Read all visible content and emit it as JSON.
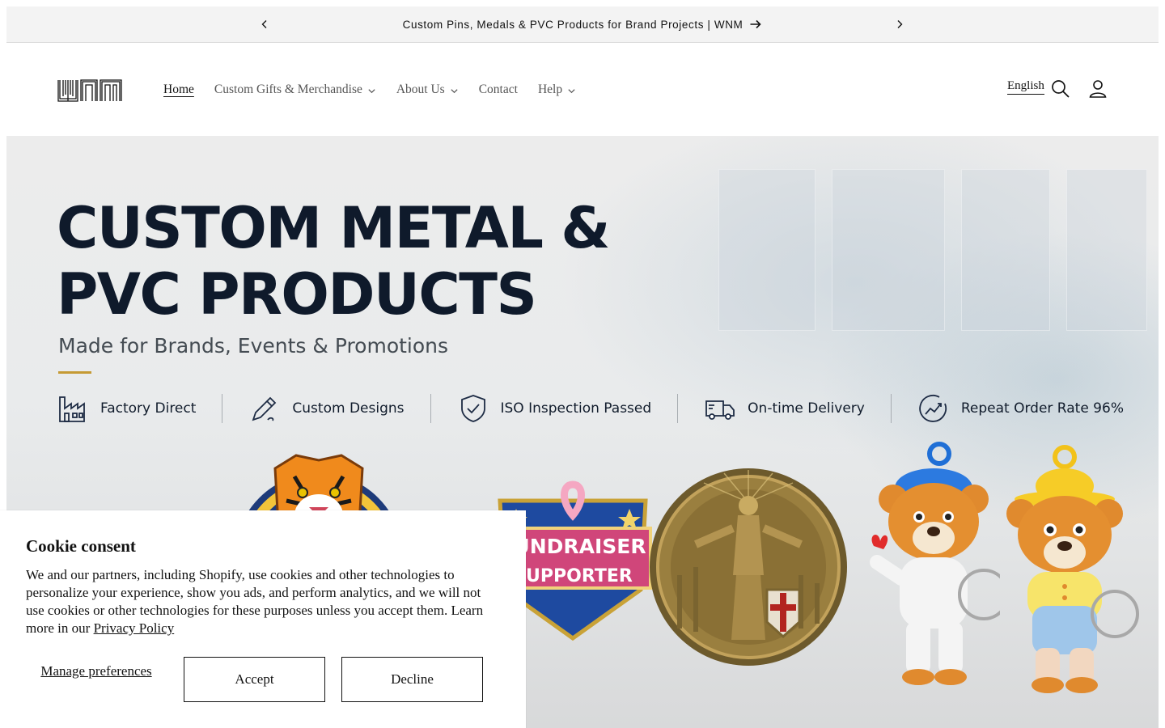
{
  "announcement": {
    "text": "Custom Pins, Medals & PVC Products for Brand Projects | WNM",
    "prev_icon": "chevron-left-icon",
    "next_icon": "chevron-right-icon",
    "arrow_icon": "arrow-right-icon"
  },
  "header": {
    "logo_text": "WNM",
    "nav": [
      {
        "label": "Home",
        "active": true,
        "dropdown": false
      },
      {
        "label": "Custom Gifts & Merchandise",
        "active": false,
        "dropdown": true
      },
      {
        "label": "About Us",
        "active": false,
        "dropdown": true
      },
      {
        "label": "Contact",
        "active": false,
        "dropdown": false
      },
      {
        "label": "Help",
        "active": false,
        "dropdown": true
      }
    ],
    "language": "English",
    "search_icon": "search-icon",
    "account_icon": "account-icon"
  },
  "hero": {
    "title": "CUSTOM METAL &\nPVC PRODUCTS",
    "subtitle": "Made for Brands, Events & Promotions",
    "features": [
      {
        "icon": "factory-icon",
        "label": "Factory Direct"
      },
      {
        "icon": "pencil-icon",
        "label": "Custom Designs"
      },
      {
        "icon": "shield-check-icon",
        "label": "ISO Inspection Passed"
      },
      {
        "icon": "delivery-truck-icon",
        "label": "On-time Delivery"
      },
      {
        "icon": "growth-chart-icon",
        "label": "Repeat Order Rate 96%"
      }
    ],
    "products": {
      "fund_pin_line1": "FUNDRAISER",
      "fund_pin_line2": "SUPPORTER"
    }
  },
  "cookie": {
    "title": "Cookie consent",
    "body": "We and our partners, including Shopify, use cookies and other technologies to personalize your experience, show you ads, and perform analytics, and we will not use cookies or other technologies for these purposes unless you accept them. Learn more in our ",
    "privacy_link": "Privacy Policy",
    "manage_label": "Manage preferences",
    "accept_label": "Accept",
    "decline_label": "Decline"
  },
  "colors": {
    "announcement_bg": "#f3f3f3",
    "title_navy": "#0f1a2b",
    "accent_gold": "#c59a34",
    "text": "#121212"
  }
}
